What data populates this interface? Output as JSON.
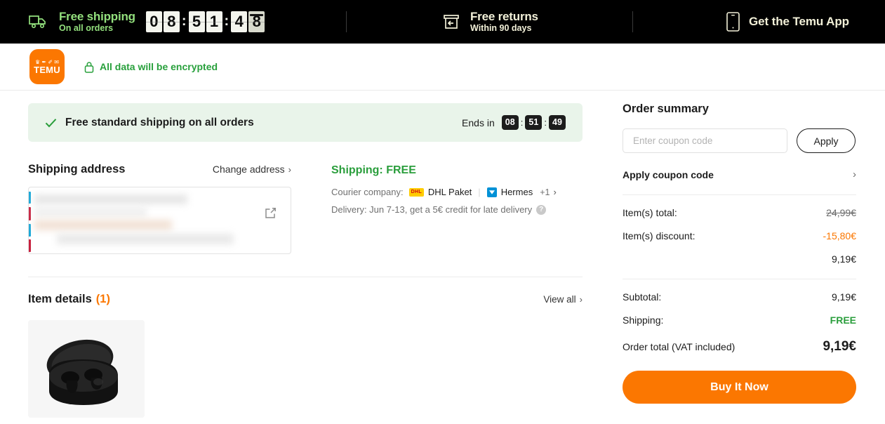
{
  "promo_bar": {
    "shipping": {
      "title": "Free shipping",
      "subtitle": "On all orders"
    },
    "timer_digits": [
      "0",
      "8",
      "5",
      "1",
      "4",
      "8"
    ],
    "timer_separator": ":",
    "returns": {
      "title": "Free returns",
      "subtitle": "Within 90 days"
    },
    "app": {
      "label": "Get the Temu App"
    }
  },
  "sub_header": {
    "logo_glyphs": "♛ ✒ ✐ ✉",
    "logo_word": "TEMU",
    "encrypted_note": "All data will be encrypted"
  },
  "shipping_banner": {
    "message": "Free standard shipping on all orders",
    "ends_in_label": "Ends in",
    "hours": "08",
    "minutes": "51",
    "seconds": "49",
    "colon": ":"
  },
  "shipping_address": {
    "title": "Shipping address",
    "change_label": "Change address",
    "chevron": "›",
    "redacted": true
  },
  "shipping_info": {
    "title": "Shipping: FREE",
    "courier_label": "Courier company:",
    "couriers": [
      {
        "name": "DHL Paket",
        "badge": "DHL"
      },
      {
        "name": "Hermes",
        "badge": ""
      }
    ],
    "more_count": "+1",
    "chevron": "›",
    "delivery": "Delivery: Jun 7-13, get a 5€ credit for late delivery",
    "help_glyph": "?"
  },
  "item_details": {
    "title": "Item details",
    "count": "(1)",
    "count_number": "1",
    "view_all": "View all",
    "chevron": "›"
  },
  "order_summary": {
    "title": "Order summary",
    "coupon_placeholder": "Enter coupon code",
    "coupon_value": "",
    "apply_label": "Apply",
    "apply_coupon_label": "Apply coupon code",
    "chevron": "›",
    "lines": [
      {
        "label": "Item(s) total:",
        "value": "24,99€",
        "style": "strike"
      },
      {
        "label": "Item(s) discount:",
        "value": "-15,80€",
        "style": "orange"
      },
      {
        "label": "",
        "value": "9,19€",
        "style": "plain"
      }
    ],
    "subtotal_label": "Subtotal:",
    "subtotal_value": "9,19€",
    "shipping_label": "Shipping:",
    "shipping_value": "FREE",
    "total_label": "Order total (VAT included)",
    "total_value": "9,19€",
    "buy_label": "Buy It Now"
  },
  "colors": {
    "brand_orange": "#fb7701",
    "promo_green": "#93e07d",
    "promo_cream": "#f2f0d8",
    "success_green": "#2a9e3c",
    "banner_bg": "#e9f4ea",
    "dhl_yellow": "#fecc00",
    "dhl_red": "#d40511",
    "hermes_blue": "#0091d6"
  }
}
